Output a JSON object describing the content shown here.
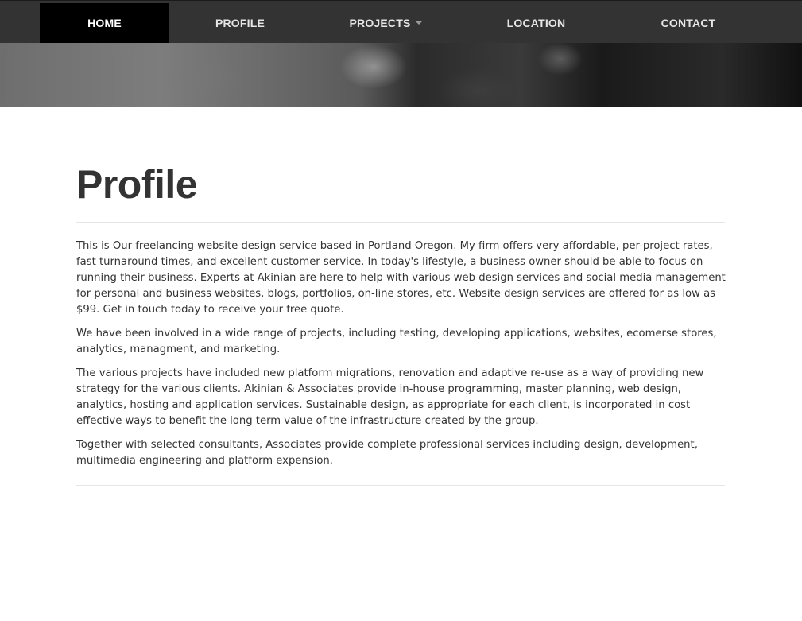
{
  "nav": {
    "items": [
      {
        "label": "HOME",
        "active": true
      },
      {
        "label": "PROFILE"
      },
      {
        "label": "PROJECTS",
        "has_dropdown": true
      },
      {
        "label": "LOCATION"
      },
      {
        "label": "CONTACT"
      }
    ]
  },
  "page": {
    "title": "Profile",
    "paragraphs": [
      "This is Our freelancing website design service based in Portland Oregon. My firm offers very affordable, per-project rates, fast turnaround times, and excellent customer service. In today's lifestyle, a business owner should be able to focus on running their business. Experts at Akinian are here to help with various web design services and social media management for personal and business websites, blogs, portfolios, on-line stores, etc. Website design services are offered for as low as $99. Get in touch today to receive your free quote.",
      "We have been involved in a wide range of projects, including testing, developing applications, websites, ecomerse stores, analytics, managment, and marketing.",
      "The various projects have included new platform migrations, renovation and adaptive re-use as a way of providing new strategy for the various clients. Akinian & Associates provide in-house programming, master planning, web design, analytics, hosting and application services. Sustainable design, as appropriate for each client, is incorporated in cost effective ways to benefit the long term value of the infrastructure created by the group.",
      "Together with selected consultants, Associates provide complete professional services including design, development, multimedia engineering and platform expension."
    ]
  },
  "colors": {
    "navbar_bg": "#333333",
    "nav_active_bg": "#000000",
    "text": "#333333",
    "divider": "#e5e5e5"
  },
  "icons": {
    "projects_dropdown": "caret-down-icon"
  }
}
